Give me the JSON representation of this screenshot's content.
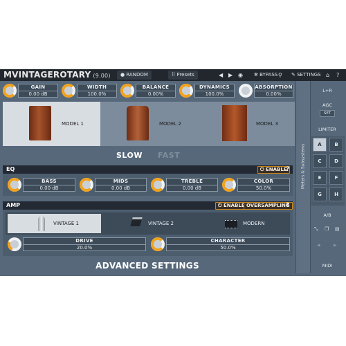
{
  "app": {
    "title": "MVINTAGEROTARY",
    "version": "(9.00)"
  },
  "topbar": {
    "random_label": "RANDOM",
    "presets_label": "Presets",
    "bypass_label": "BYPASS",
    "settings_label": "SETTINGS"
  },
  "knobs": [
    {
      "name": "GAIN",
      "value": "0.00 dB",
      "level": 0.5
    },
    {
      "name": "WIDTH",
      "value": "100.0%",
      "level": 0.5
    },
    {
      "name": "BALANCE",
      "value": "0.00%",
      "level": 0.5
    },
    {
      "name": "DYNAMICS",
      "value": "100.0%",
      "level": 0.5
    },
    {
      "name": "ABSORPTION",
      "value": "0.00%",
      "level": 0.0
    }
  ],
  "models": [
    "MODEL 1",
    "MODEL 2",
    "MODEL 3"
  ],
  "speed": {
    "slow": "SLOW",
    "fast": "FAST"
  },
  "eq": {
    "title": "EQ",
    "enable_label": "ENABLE",
    "help": "?",
    "knobs": [
      {
        "name": "BASS",
        "value": "0.00 dB",
        "level": 0.5
      },
      {
        "name": "MIDS",
        "value": "0.00 dB",
        "level": 0.5
      },
      {
        "name": "TREBLE",
        "value": "0.00 dB",
        "level": 0.5
      },
      {
        "name": "COLOR",
        "value": "50.0%",
        "level": 0.5
      }
    ]
  },
  "amp": {
    "title": "AMP",
    "enable_label": "ENABLE",
    "oversampling_label": "OVERSAMPLING",
    "help": "?",
    "types": [
      "VINTAGE 1",
      "VINTAGE 2",
      "MODERN"
    ],
    "knobs": [
      {
        "name": "DRIVE",
        "value": "20.0%",
        "level": 0.2
      },
      {
        "name": "CHARACTER",
        "value": "50.0%",
        "level": 0.5
      }
    ]
  },
  "advanced_label": "ADVANCED SETTINGS",
  "meters_label": "Meters & Subsystems",
  "right": {
    "lr": "L+R",
    "agc": "AGC",
    "set": "SET",
    "limiter": "LIMITER",
    "keys": [
      "A",
      "B",
      "C",
      "D",
      "E",
      "F",
      "G",
      "H"
    ],
    "ab": "A/B",
    "midi": "MIDI"
  },
  "colors": {
    "accent": "#f1a21c",
    "background": "#56687a",
    "header": "#232a33"
  }
}
